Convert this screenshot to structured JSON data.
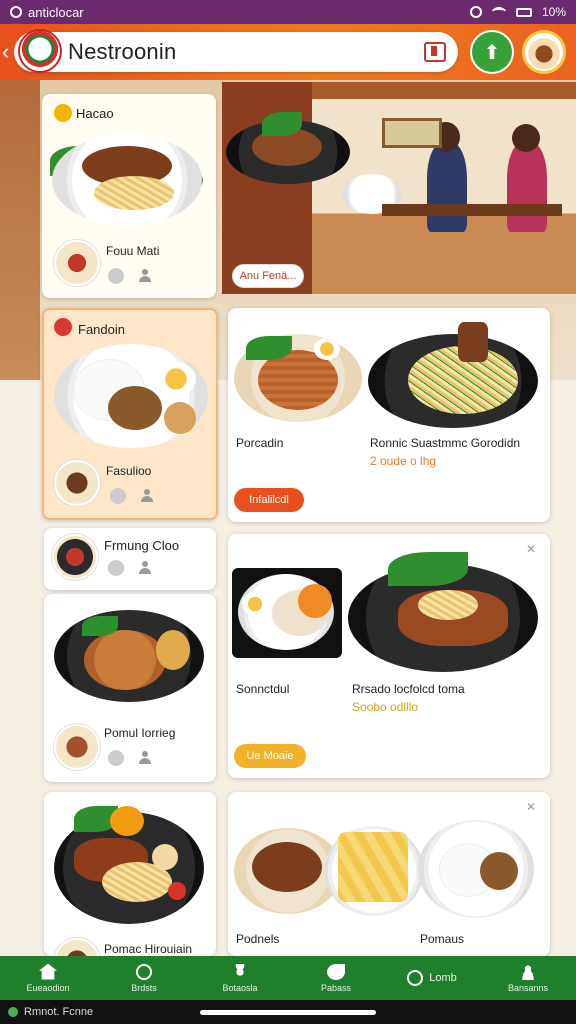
{
  "status_bar": {
    "carrier": "anticlocar",
    "battery": "10%"
  },
  "header": {
    "title": "Nestroonin"
  },
  "hero": {
    "button_label": "Anu Fenä..."
  },
  "cards": {
    "c1": {
      "title": "Hacao",
      "subtitle": "Fouu Mati"
    },
    "c2": {
      "title": "Fandoin",
      "subtitle": "Fasulioo"
    },
    "c3": {
      "title": "Frmung Cloo"
    },
    "c4": {
      "subtitle": "Pomul Iorrieg"
    },
    "c5": {
      "subtitle": "Pomac Hirouiain"
    },
    "r1": {
      "left_label": "Porcadin",
      "right_label": "Ronnic Suastmmc Gorodidn",
      "price": "2 oude o lhg",
      "button": "Infalilcdl"
    },
    "r2": {
      "left_label": "Sonnctdul",
      "right_label": "Rrsado locfolcd toma",
      "price": "Soobo odlllo",
      "button": "Ue Moaie"
    },
    "r3": {
      "left_label": "Podnels",
      "right_label": "Pomaus"
    }
  },
  "nav": [
    {
      "label": "Eueaodion",
      "icon": "home-icon"
    },
    {
      "label": "Brdsts",
      "icon": "search-icon"
    },
    {
      "label": "Botaosla",
      "icon": "flower-icon"
    },
    {
      "label": "Pabass",
      "icon": "leaf-icon"
    },
    {
      "label": "Lomb",
      "icon": "check-icon"
    },
    {
      "label": "Bansanns",
      "icon": "people-icon"
    }
  ],
  "system_bar": {
    "label": "Rmnot. Fcnne"
  }
}
